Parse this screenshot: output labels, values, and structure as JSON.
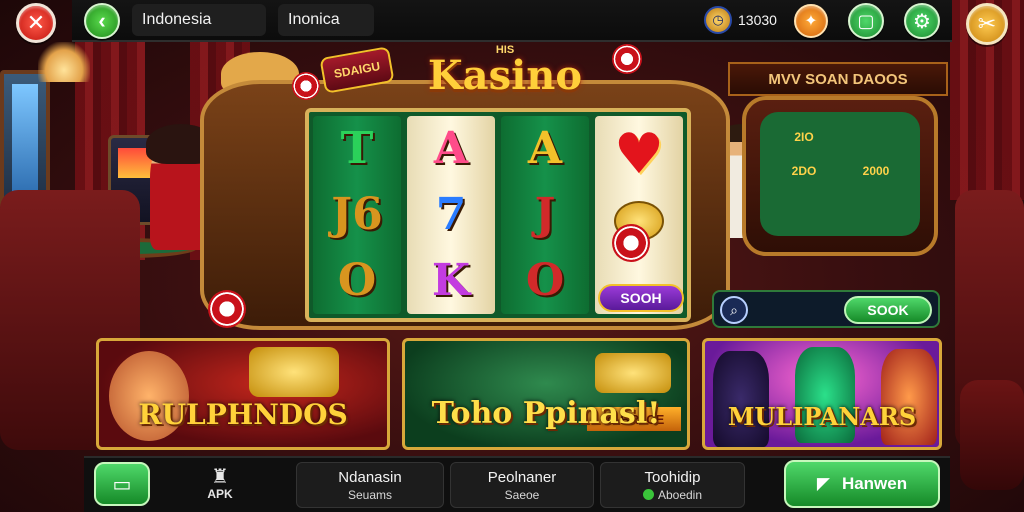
{
  "topbar": {
    "country_tab": "Indonesia",
    "region_tab": "Inonica",
    "coins_value": "13030"
  },
  "icons": {
    "close": "close-icon",
    "back": "chevron-left-icon",
    "coin": "coin-icon",
    "gift": "gift-icon",
    "screen": "screen-icon",
    "settings": "gear-icon",
    "tools": "tools-icon",
    "home": "home-icon",
    "apk": "android-icon",
    "play": "arrow-icon"
  },
  "main": {
    "logo_small": "HIS",
    "logo_title": "Kasino",
    "badge": "SDAIGU",
    "spin_button": "SOOH",
    "reels": [
      [
        "T",
        "J6",
        "O"
      ],
      [
        "A",
        "7",
        "K"
      ],
      [
        "A",
        "J",
        "O"
      ],
      [
        "♥",
        "",
        ""
      ]
    ]
  },
  "side_table": {
    "sign": "MVV SOAN DAOOS",
    "cells": [
      "2IO",
      "",
      "2DO",
      "2000",
      "",
      "",
      "",
      ""
    ],
    "search_button": "SOOK"
  },
  "tiles": [
    {
      "title": "RULPHNDOS"
    },
    {
      "title": "Toho Ppinasl!",
      "sub": "3ABR3CE"
    },
    {
      "title": "MULIPANARS"
    }
  ],
  "bottom": {
    "apk_label": "APK",
    "nav": [
      {
        "line1": "Ndanasin",
        "line2": "Seuams"
      },
      {
        "line1": "Peolnaner",
        "line2": "Saeoe"
      },
      {
        "line1": "Toohidip",
        "line2": "Aboedin"
      }
    ],
    "play_button": "Hanwen"
  },
  "colors": {
    "accent_green": "#1f8a1a",
    "accent_gold": "#f3c12a",
    "close_red": "#c1140e"
  }
}
